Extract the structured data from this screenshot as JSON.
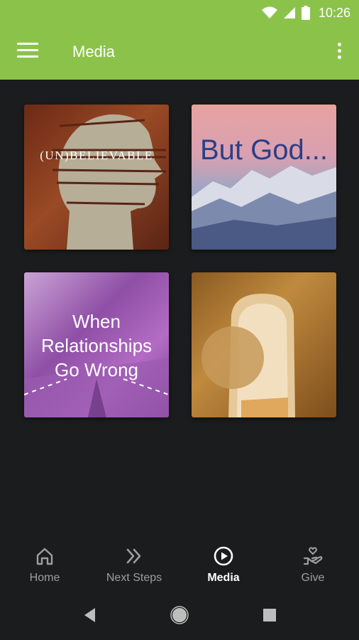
{
  "status_bar": {
    "time": "10:26"
  },
  "app_bar": {
    "title": "Media"
  },
  "media": {
    "items": [
      {
        "title": "(UN)BELIEVABLE"
      },
      {
        "title": "But God..."
      },
      {
        "title": "When Relationships Go Wrong",
        "lines": [
          "When",
          "Relationships",
          "Go Wrong"
        ]
      },
      {
        "title": ""
      }
    ]
  },
  "bottom_nav": {
    "items": [
      {
        "label": "Home",
        "icon": "home-icon"
      },
      {
        "label": "Next Steps",
        "icon": "double-chevron-icon"
      },
      {
        "label": "Media",
        "icon": "play-circle-icon",
        "active": true
      },
      {
        "label": "Give",
        "icon": "hand-heart-icon"
      }
    ]
  },
  "colors": {
    "app_bar": "#8bc34a",
    "background": "#1b1c1d",
    "nav_inactive": "#9e9e9e",
    "nav_active": "#ffffff"
  }
}
